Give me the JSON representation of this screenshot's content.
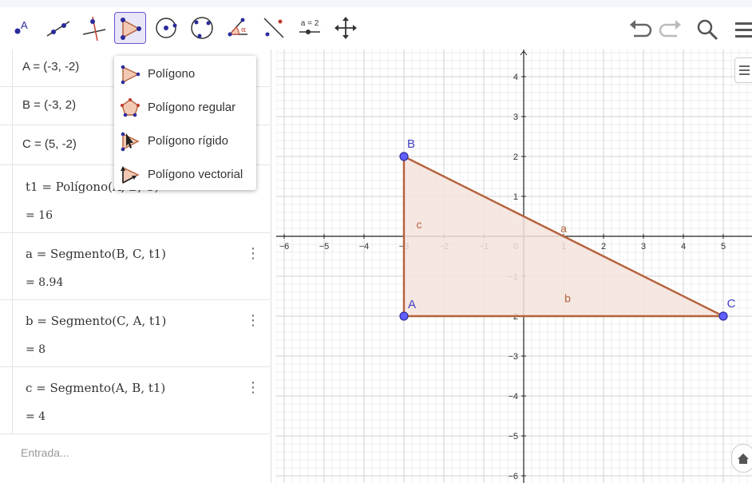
{
  "toolbar": {
    "tools": [
      {
        "name": "point-tool",
        "label": "A"
      },
      {
        "name": "line-tool"
      },
      {
        "name": "perpendicular-tool"
      },
      {
        "name": "polygon-tool"
      },
      {
        "name": "circle-tool"
      },
      {
        "name": "circle-through-points-tool"
      },
      {
        "name": "angle-tool",
        "label": "α"
      },
      {
        "name": "reflect-tool"
      },
      {
        "name": "slider-tool",
        "label": "a = 2"
      },
      {
        "name": "move-graphics-tool"
      }
    ],
    "right": [
      "undo-icon",
      "redo-icon",
      "search-icon",
      "menu-icon"
    ]
  },
  "algebra": {
    "rows": [
      {
        "definition": "A = (-3, -2)"
      },
      {
        "definition": "B = (-3, 2)"
      },
      {
        "definition": "C = (5, -2)"
      },
      {
        "definition": "t1 = Polígono(A, B, C)",
        "value": "= 16"
      },
      {
        "definition": "a = Segmento(B, C, t1)",
        "value": "= 8.94"
      },
      {
        "definition": "b = Segmento(C, A, t1)",
        "value": "= 8"
      },
      {
        "definition": "c = Segmento(A, B, t1)",
        "value": "= 4"
      }
    ],
    "input_placeholder": "Entrada..."
  },
  "polygon_menu": {
    "items": [
      {
        "label": "Polígono"
      },
      {
        "label": "Polígono regular"
      },
      {
        "label": "Polígono rígido"
      },
      {
        "label": "Polígono vectorial"
      }
    ]
  },
  "graphics": {
    "x_ticks": [
      "−6",
      "−5",
      "−4",
      "−3",
      "−2",
      "−1",
      "0",
      "1",
      "2",
      "3",
      "4",
      "5"
    ],
    "y_ticks": [
      "4",
      "3",
      "2",
      "1",
      "−1",
      "−2",
      "−3",
      "−4",
      "−5",
      "−6"
    ],
    "points": [
      {
        "label": "A",
        "x": -3,
        "y": -2
      },
      {
        "label": "B",
        "x": -3,
        "y": 2
      },
      {
        "label": "C",
        "x": 5,
        "y": -2
      }
    ],
    "segment_labels": [
      "a",
      "b",
      "c"
    ],
    "colors": {
      "polygon_stroke": "#b4623c",
      "polygon_fill": "#f5e3dc",
      "point_fill": "#6060ff",
      "point_stroke": "#2c2c9a",
      "label": "#4040c0",
      "grid_major": "#d0d0d0",
      "grid_minor": "#ececec",
      "accent": "#6557d2"
    }
  }
}
